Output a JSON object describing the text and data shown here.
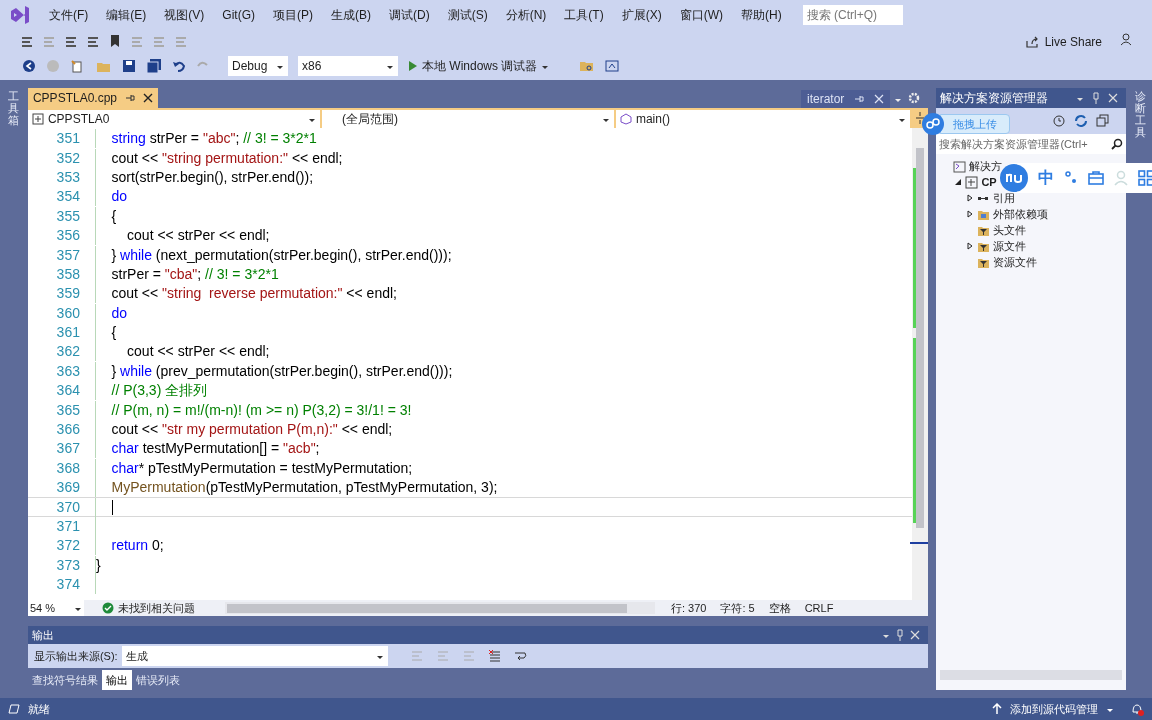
{
  "menu": [
    "文件(F)",
    "编辑(E)",
    "视图(V)",
    "Git(G)",
    "项目(P)",
    "生成(B)",
    "调试(D)",
    "测试(S)",
    "分析(N)",
    "工具(T)",
    "扩展(X)",
    "窗口(W)",
    "帮助(H)"
  ],
  "search": {
    "placeholder": "搜索 (Ctrl+Q)"
  },
  "live_share": "Live Share",
  "toolbar": {
    "configuration": "Debug",
    "platform": "x86",
    "run": "本地 Windows 调试器"
  },
  "left_side_tab": "工具箱",
  "right_side_tab": "诊断工具",
  "editor": {
    "tab": {
      "title": "CPPSTLA0.cpp",
      "selected": true
    },
    "preview_tab": {
      "title": "iterator",
      "selected": false
    },
    "nav": {
      "project": "CPPSTLA0",
      "scope": "(全局范围)",
      "member": "main()"
    },
    "lines": [
      {
        "number": "351",
        "current": false,
        "tokens": [
          {
            "kind": "keyword",
            "t": "    string"
          },
          {
            "kind": "plain",
            "t": " strPer = "
          },
          {
            "kind": "string",
            "t": "\"abc\""
          },
          {
            "kind": "plain",
            "t": "; "
          },
          {
            "kind": "comment",
            "t": "// 3! = 3*2*1"
          }
        ]
      },
      {
        "number": "352",
        "current": false,
        "tokens": [
          {
            "kind": "plain",
            "t": "    cout << "
          },
          {
            "kind": "string",
            "t": "\"string permutation:\""
          },
          {
            "kind": "plain",
            "t": " << endl;"
          }
        ]
      },
      {
        "number": "353",
        "current": false,
        "tokens": [
          {
            "kind": "plain",
            "t": "    sort(strPer.begin(), strPer.end());"
          }
        ]
      },
      {
        "number": "354",
        "current": false,
        "tokens": [
          {
            "kind": "keyword",
            "t": "    do"
          }
        ]
      },
      {
        "number": "355",
        "current": false,
        "tokens": [
          {
            "kind": "plain",
            "t": "    {"
          }
        ]
      },
      {
        "number": "356",
        "current": false,
        "tokens": [
          {
            "kind": "plain",
            "t": "        cout << strPer << endl;"
          }
        ]
      },
      {
        "number": "357",
        "current": false,
        "tokens": [
          {
            "kind": "plain",
            "t": "    } "
          },
          {
            "kind": "keyword",
            "t": "while"
          },
          {
            "kind": "plain",
            "t": " (next_permutation(strPer.begin(), strPer.end()));"
          }
        ]
      },
      {
        "number": "358",
        "current": false,
        "tokens": [
          {
            "kind": "plain",
            "t": "    strPer = "
          },
          {
            "kind": "string",
            "t": "\"cba\""
          },
          {
            "kind": "plain",
            "t": "; "
          },
          {
            "kind": "comment",
            "t": "// 3! = 3*2*1"
          }
        ]
      },
      {
        "number": "359",
        "current": false,
        "tokens": [
          {
            "kind": "plain",
            "t": "    cout << "
          },
          {
            "kind": "string",
            "t": "\"string  reverse permutation:\""
          },
          {
            "kind": "plain",
            "t": " << endl;"
          }
        ]
      },
      {
        "number": "360",
        "current": false,
        "tokens": [
          {
            "kind": "keyword",
            "t": "    do"
          }
        ]
      },
      {
        "number": "361",
        "current": false,
        "tokens": [
          {
            "kind": "plain",
            "t": "    {"
          }
        ]
      },
      {
        "number": "362",
        "current": false,
        "tokens": [
          {
            "kind": "plain",
            "t": "        cout << strPer << endl;"
          }
        ]
      },
      {
        "number": "363",
        "current": false,
        "tokens": [
          {
            "kind": "plain",
            "t": "    } "
          },
          {
            "kind": "keyword",
            "t": "while"
          },
          {
            "kind": "plain",
            "t": " (prev_permutation(strPer.begin(), strPer.end()));"
          }
        ]
      },
      {
        "number": "364",
        "current": false,
        "tokens": [
          {
            "kind": "comment",
            "t": "    // P(3,3) 全排列"
          }
        ]
      },
      {
        "number": "365",
        "current": false,
        "tokens": [
          {
            "kind": "comment",
            "t": "    // P(m, n) = m!/(m-n)! (m >= n) P(3,2) = 3!/1! = 3!"
          }
        ]
      },
      {
        "number": "366",
        "current": false,
        "tokens": [
          {
            "kind": "plain",
            "t": "    cout << "
          },
          {
            "kind": "string",
            "t": "\"str my permutation P(m,n):\""
          },
          {
            "kind": "plain",
            "t": " << endl;"
          }
        ]
      },
      {
        "number": "367",
        "current": false,
        "tokens": [
          {
            "kind": "keyword",
            "t": "    char"
          },
          {
            "kind": "plain",
            "t": " testMyPermutation[] = "
          },
          {
            "kind": "string",
            "t": "\"acb\""
          },
          {
            "kind": "plain",
            "t": ";"
          }
        ]
      },
      {
        "number": "368",
        "current": false,
        "tokens": [
          {
            "kind": "keyword",
            "t": "    char"
          },
          {
            "kind": "plain",
            "t": "* pTestMyPermutation = testMyPermutation;"
          }
        ]
      },
      {
        "number": "369",
        "current": false,
        "tokens": [
          {
            "kind": "function",
            "t": "    MyPermutation"
          },
          {
            "kind": "plain",
            "t": "(pTestMyPermutation, pTestMyPermutation, 3);"
          }
        ]
      },
      {
        "number": "370",
        "current": true
      },
      {
        "number": "371",
        "current": false
      },
      {
        "number": "372",
        "current": false,
        "tokens": [
          {
            "kind": "keyword",
            "t": "    return"
          },
          {
            "kind": "plain",
            "t": " 0;"
          }
        ]
      },
      {
        "number": "373",
        "current": false,
        "tokens": [
          {
            "kind": "plain",
            "t": "}"
          }
        ]
      },
      {
        "number": "374",
        "current": false
      }
    ],
    "zoom": "54 %",
    "issues": "未找到相关问题",
    "position": [
      "行: 370",
      "字符: 5",
      "空格",
      "CRLF"
    ]
  },
  "output": {
    "title": "输出",
    "source_label": "显示输出来源(S):",
    "source": "生成",
    "tabs": [
      {
        "label": "查找符号结果",
        "selected": false
      },
      {
        "label": "输出",
        "selected": true
      },
      {
        "label": "错误列表",
        "selected": false
      }
    ]
  },
  "solution_explorer": {
    "title": "解决方案资源管理器",
    "search_placeholder": "搜索解决方案资源管理器(Ctrl+",
    "tree": [
      {
        "label": "解决方",
        "kind": "solution",
        "children": [
          {
            "label": "CP",
            "kind": "project",
            "expanded": true,
            "children": [
              {
                "label": "引用",
                "kind": "references",
                "expanded": false
              },
              {
                "label": "外部依赖项",
                "kind": "external",
                "expanded": false
              },
              {
                "label": "头文件",
                "kind": "filter"
              },
              {
                "label": "源文件",
                "kind": "filter",
                "expanded": false
              },
              {
                "label": "资源文件",
                "kind": "filter"
              }
            ]
          }
        ]
      }
    ]
  },
  "upload_popup": "拖拽上传",
  "ime_toolbar": {
    "mode": "中"
  },
  "status_bar": {
    "text": "就绪",
    "source_control": "添加到源代码管理"
  }
}
